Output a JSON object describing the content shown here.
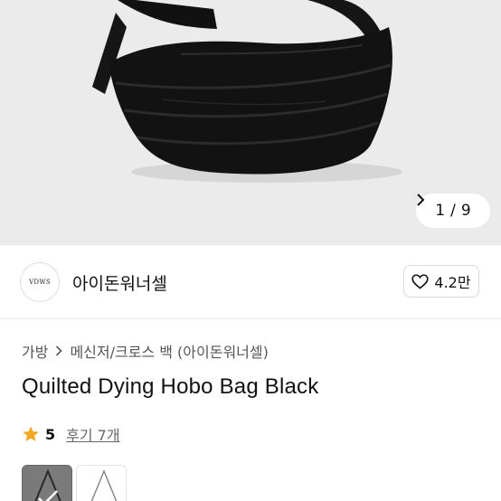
{
  "gallery": {
    "current_page": "1",
    "total_pages": "9",
    "separator": "/"
  },
  "seller": {
    "logo_text": "VDWS",
    "name": "아이돈워너셀",
    "like_count": "4.2만"
  },
  "breadcrumb": {
    "items": [
      "가방",
      "메신저/크로스 백 (아이돈워너셀)"
    ]
  },
  "product": {
    "title": "Quilted Dying Hobo Bag Black",
    "rating": "5",
    "review_label": "후기 7개"
  },
  "colors": {
    "star": "#f5a623",
    "hero_bg": "#ebebeb"
  },
  "icons": {
    "next": "chevron-right-icon",
    "like": "heart-outline-icon",
    "rating": "star-icon"
  }
}
